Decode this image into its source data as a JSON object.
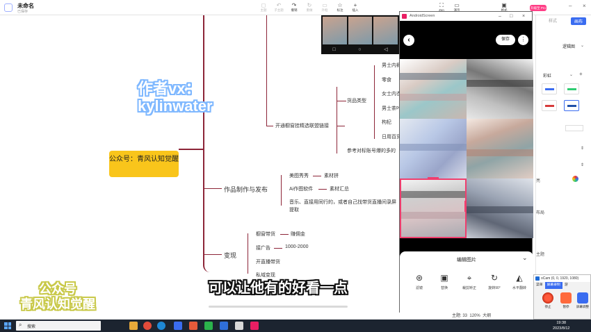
{
  "app": {
    "title": "未命名",
    "status": "已保存"
  },
  "toolbar": {
    "items": [
      {
        "icon": "◻",
        "label": "主题"
      },
      {
        "icon": "↶",
        "label": "子主题"
      },
      {
        "icon": "↷",
        "label": "撤销"
      },
      {
        "icon": "↻",
        "label": "重做"
      },
      {
        "icon": "▭",
        "label": "外框"
      },
      {
        "icon": "☆",
        "label": "标注"
      },
      {
        "icon": "+",
        "label": "插入"
      }
    ],
    "right_items": [
      {
        "icon": "⛶",
        "label": "Zen"
      },
      {
        "icon": "▭",
        "label": "演示"
      },
      {
        "icon": "▣",
        "label": "格式"
      }
    ],
    "pro_label": "升级至 Pro"
  },
  "mindmap": {
    "root": "公众号：青风认知觉醒",
    "branch1": {
      "label": "开通橱窗挂精选联盟链接",
      "sub": [
        {
          "label": "货品类型",
          "items": [
            "男士内裤",
            "零食",
            "女士内衣",
            "男士茶叶",
            "枸杞",
            "日用百货"
          ]
        },
        {
          "label": "参考对标账号爆的多的"
        }
      ]
    },
    "branch2": {
      "label": "作品制作与发布",
      "items": [
        {
          "label": "美图秀秀",
          "leaf": "素材拼"
        },
        {
          "label": "Ai作图软件",
          "leaf": "素材汇总"
        },
        {
          "label": "音乐、直接用同行的，或者自己找带货直播间录屏提取"
        }
      ]
    },
    "branch3": {
      "label": "变现",
      "items": [
        {
          "label": "橱窗带货",
          "leaf": "赚佣金"
        },
        {
          "label": "接广告",
          "leaf": "1000-2000"
        },
        {
          "label": "开直播带货"
        },
        {
          "label": "私域变现"
        }
      ]
    }
  },
  "overlays": {
    "vx_watermark": "作者vx：kylinwater",
    "gzh_watermark": "公众号\n青风认知觉醒",
    "subtitle": "可以让他有的好看一点"
  },
  "android_window": {
    "title": "AndroidScreen",
    "save_label": "保存",
    "more_label": "⋮",
    "back_label": "‹",
    "edit_title": "编辑图片",
    "tools": [
      {
        "icon": "⊛",
        "label": "滤镜",
        "name": "filter-icon"
      },
      {
        "icon": "▣",
        "label": "替换",
        "name": "replace-icon"
      },
      {
        "icon": "⌖",
        "label": "裁剪矫正",
        "name": "crop-icon"
      },
      {
        "icon": "↻",
        "label": "旋转90°",
        "name": "rotate-icon"
      },
      {
        "icon": "◭",
        "label": "水平翻转",
        "name": "flip-icon"
      }
    ]
  },
  "right_panel": {
    "tabs": [
      "样式",
      "画布"
    ],
    "theme_select": "逻辑图",
    "color_select": "彩虹",
    "sections": [
      "亮",
      "布局",
      "主题"
    ]
  },
  "zoom_bar": {
    "topic_count": "主题: 33",
    "zoom": "120%",
    "size_label": "大纲"
  },
  "ocam": {
    "title": "oCam (0, 0, 1920, 1080)",
    "tabs": [
      "菜单",
      "屏幕录制",
      "游"
    ],
    "buttons": [
      "停止",
      "暂停",
      "屏幕调整"
    ]
  },
  "taskbar": {
    "search_placeholder": "搜索",
    "time": "19:38",
    "date": "2023/8/12"
  },
  "colors": {
    "branch": "#8c2437",
    "root_fill": "#f9c51b",
    "accent": "#3a6cf0",
    "pro": "#ff3e86",
    "crop": "#f03e6e"
  }
}
